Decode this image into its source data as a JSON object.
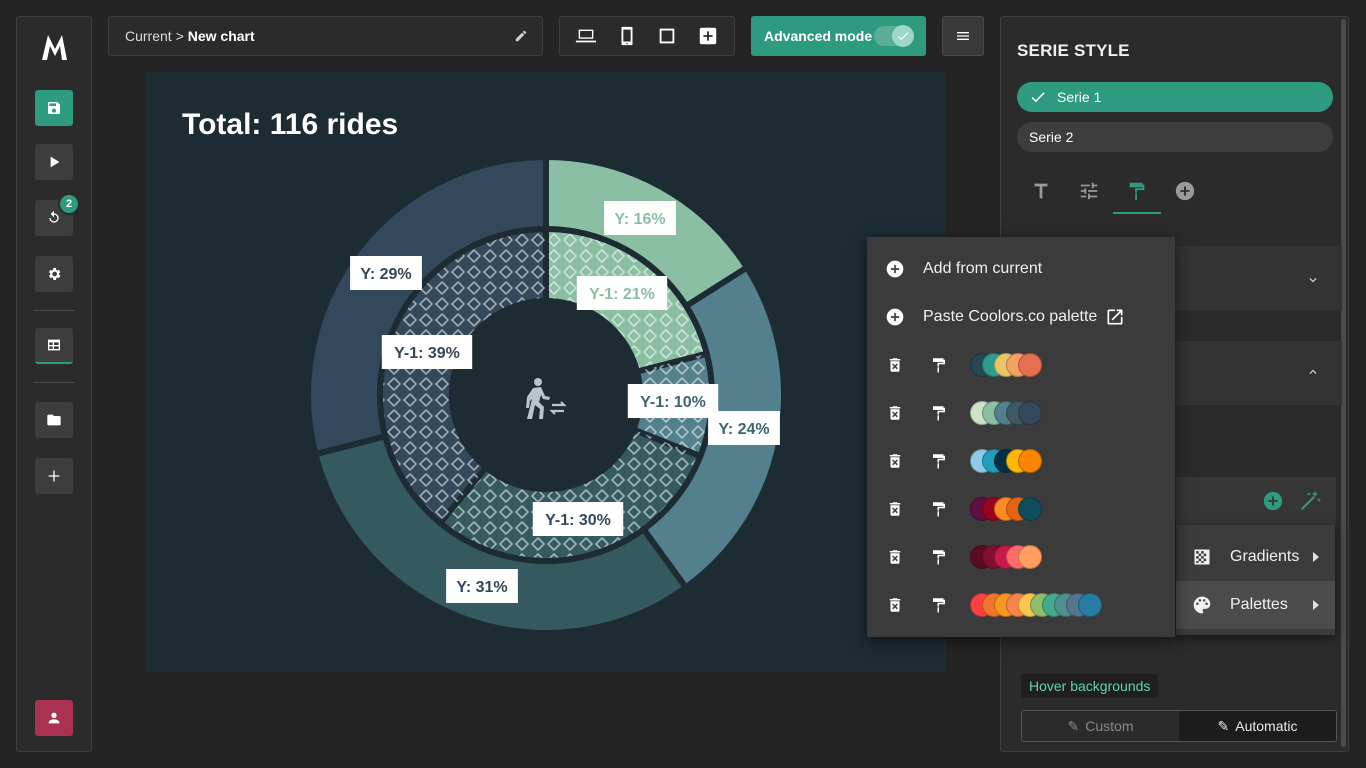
{
  "rail": {
    "logo": "M",
    "history_badge": "2",
    "buttons": [
      "save-icon",
      "play-icon",
      "history-icon",
      "gear-icon",
      "table-icon",
      "folder-icon",
      "plus-icon",
      "user-icon"
    ]
  },
  "breadcrumb": {
    "current": "Current >",
    "chart": "New chart"
  },
  "toolbar": {
    "advanced_label": "Advanced mode",
    "advanced_on": true
  },
  "chart": {
    "title": "Total: 116 rides",
    "background": "#1d2b33",
    "center_icon": "walk-transfer-icon"
  },
  "chart_data": {
    "type": "donut",
    "title": "Total: 116 rides",
    "series": [
      {
        "name": "Y",
        "values": [
          16,
          24,
          31,
          29
        ],
        "labels": [
          "Y: 16%",
          "Y: 24%",
          "Y: 31%",
          "Y: 29%"
        ],
        "colors": [
          "#8bbfa3",
          "#53808c",
          "#345a5f",
          "#33485a"
        ]
      },
      {
        "name": "Y-1",
        "values": [
          21,
          10,
          30,
          39
        ],
        "labels": [
          "Y-1: 21%",
          "Y-1: 10%",
          "Y-1: 30%",
          "Y-1: 39%"
        ],
        "colors": [
          "#8bbfa3",
          "#53808c",
          "#345a5f",
          "#33485a"
        ]
      }
    ]
  },
  "panel": {
    "title": "SERIE STYLE",
    "series": [
      "Serie 1",
      "Serie 2"
    ],
    "tabs": [
      "text-icon",
      "sliders-icon",
      "paint-roller-icon",
      "plus-circle-icon"
    ],
    "hover_backgrounds": "Hover backgrounds",
    "mode_custom": "Custom",
    "mode_automatic": "Automatic"
  },
  "submenu": {
    "gradients": "Gradients",
    "palettes": "Palettes"
  },
  "popover": {
    "add_from_current": "Add from current",
    "paste_coolors": "Paste Coolors.co palette",
    "palettes": [
      [
        "#264653",
        "#2a9d8f",
        "#e9c46a",
        "#f4a261",
        "#e76f51"
      ],
      [
        "#cce3c8",
        "#8bbfa3",
        "#53808c",
        "#3d5a64",
        "#33485a"
      ],
      [
        "#8ecae6",
        "#219ebc",
        "#023047",
        "#ffb703",
        "#fb8500"
      ],
      [
        "#5f0f40",
        "#9a031e",
        "#fb8b24",
        "#e36414",
        "#0f4c5c"
      ],
      [
        "#590d22",
        "#800f2f",
        "#c9184a",
        "#ff6b6b",
        "#ff9e5e"
      ],
      [
        "#f94144",
        "#f3722c",
        "#f8961e",
        "#f9844a",
        "#f9c74f",
        "#90be6d",
        "#43aa8b",
        "#4d908e",
        "#577590",
        "#277da1"
      ]
    ]
  }
}
